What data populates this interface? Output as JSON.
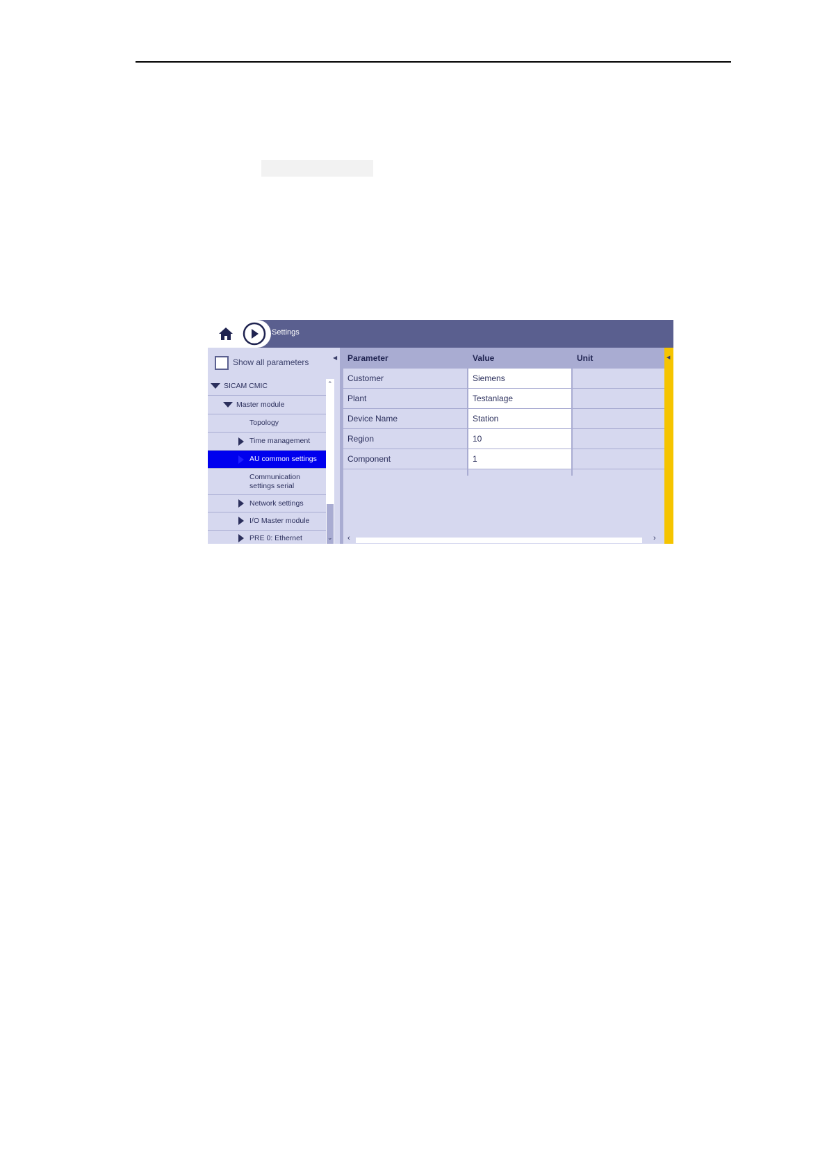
{
  "window": {
    "title": "Settings"
  },
  "icons": {
    "home": "home-icon",
    "forward": "play-icon"
  },
  "left_panel": {
    "show_all_label": "Show all parameters",
    "tree": [
      {
        "label": "SICAM CMIC",
        "level": 0,
        "toggle": "expanded"
      },
      {
        "label": "Master module",
        "level": 1,
        "toggle": "expanded"
      },
      {
        "label": "Topology",
        "level": 2,
        "toggle": "none"
      },
      {
        "label": "Time management",
        "level": 2,
        "toggle": "collapsed"
      },
      {
        "label": "AU common settings",
        "level": 2,
        "toggle": "collapsed",
        "selected": true
      },
      {
        "label_line1": "Communication",
        "label_line2": "settings serial",
        "level": 2,
        "toggle": "none"
      },
      {
        "label": "Network settings",
        "level": 2,
        "toggle": "collapsed"
      },
      {
        "label": "I/O Master module",
        "level": 2,
        "toggle": "collapsed"
      },
      {
        "label": "PRE 0: Ethernet",
        "level": 2,
        "toggle": "collapsed"
      }
    ]
  },
  "table": {
    "columns": [
      "Parameter",
      "Value",
      "Unit"
    ],
    "rows": [
      {
        "parameter": "Customer",
        "value": "Siemens",
        "unit": ""
      },
      {
        "parameter": "Plant",
        "value": "Testanlage",
        "unit": ""
      },
      {
        "parameter": "Device Name",
        "value": "Station",
        "unit": ""
      },
      {
        "parameter": "Region",
        "value": "10",
        "unit": ""
      },
      {
        "parameter": "Component",
        "value": "1",
        "unit": ""
      }
    ]
  },
  "colors": {
    "title_bar": "#5a5f8f",
    "panel_bg": "#d6d8ef",
    "header_bg": "#a9acd2",
    "selection": "#0000ee",
    "accent_bar": "#f5c400"
  }
}
